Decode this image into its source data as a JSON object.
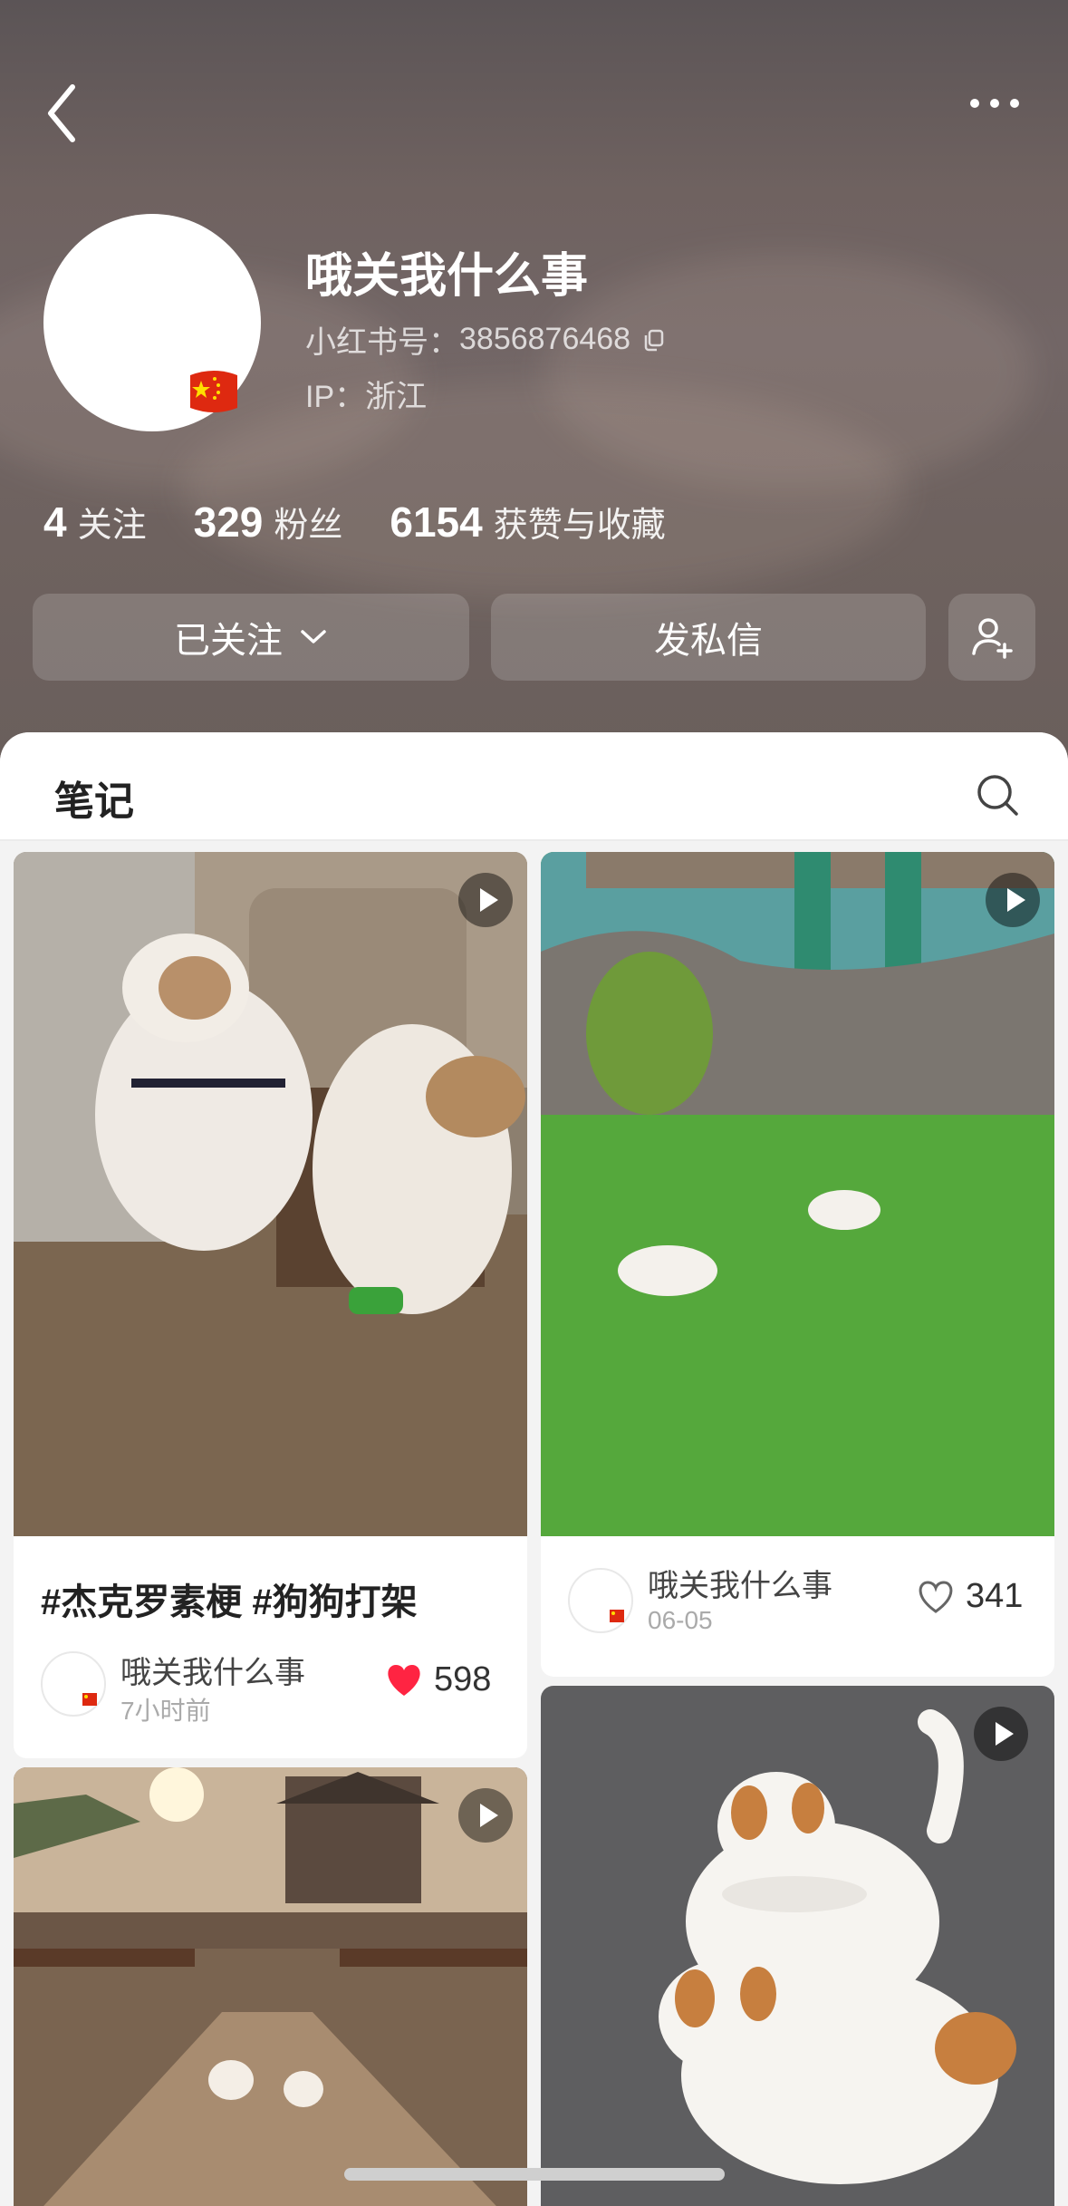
{
  "profile": {
    "name": "哦关我什么事",
    "red_id_label": "小红书号：",
    "red_id": "3856876468",
    "ip_label": "IP：",
    "ip_value": "浙江"
  },
  "stats": [
    {
      "num": "4",
      "label": "关注"
    },
    {
      "num": "329",
      "label": "粉丝"
    },
    {
      "num": "6154",
      "label": "获赞与收藏"
    }
  ],
  "actions": {
    "follow_label": "已关注",
    "message_label": "发私信"
  },
  "tabs": {
    "notes": "笔记"
  },
  "cards": [
    {
      "title": "#杰克罗素梗 #狗狗打架",
      "author": "哦关我什么事",
      "time": "7小时前",
      "likes": "598",
      "liked": true
    },
    {
      "title": "",
      "author": "哦关我什么事",
      "time": "06-05",
      "likes": "341",
      "liked": false
    }
  ],
  "icons": [
    "back-icon",
    "more-icon",
    "chevron-down-icon",
    "add-user-icon",
    "search-icon",
    "play-icon",
    "heart-icon",
    "copy-icon",
    "china-flag-icon"
  ],
  "colors": {
    "accent_heart": "#ff2442",
    "hero_bg": "#6e625f"
  }
}
